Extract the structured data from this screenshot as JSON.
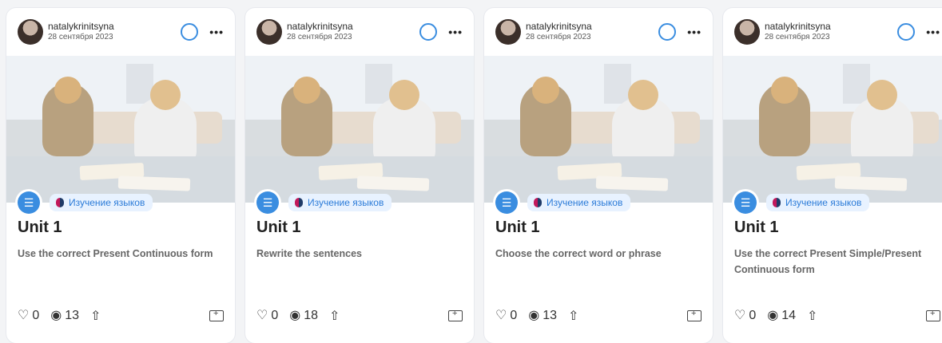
{
  "cards": [
    {
      "user": {
        "name": "natalykrinitsyna",
        "date": "28 сентября 2023"
      },
      "category": "Изучение языков",
      "title": "Unit 1",
      "description": "Use the correct Present Continuous form",
      "likes": "0",
      "views": "13"
    },
    {
      "user": {
        "name": "natalykrinitsyna",
        "date": "28 сентября 2023"
      },
      "category": "Изучение языков",
      "title": "Unit 1",
      "description": "Rewrite the sentences",
      "likes": "0",
      "views": "18"
    },
    {
      "user": {
        "name": "natalykrinitsyna",
        "date": "28 сентября 2023"
      },
      "category": "Изучение языков",
      "title": "Unit 1",
      "description": "Choose the correct word or phrase",
      "likes": "0",
      "views": "13"
    },
    {
      "user": {
        "name": "natalykrinitsyna",
        "date": "28 сентября 2023"
      },
      "category": "Изучение языков",
      "title": "Unit 1",
      "description": "Use the correct Present Simple/Present Continuous form",
      "likes": "0",
      "views": "14"
    }
  ],
  "icons": {
    "more": "more-icon",
    "status": "circle-outline-icon",
    "like": "heart-icon",
    "views": "eye-icon",
    "share": "share-icon",
    "save": "folder-plus-icon",
    "category": "list-icon"
  },
  "colors": {
    "accent": "#3a8de0",
    "pill_bg": "#e8f2ff",
    "pill_text": "#2b7bd8"
  }
}
